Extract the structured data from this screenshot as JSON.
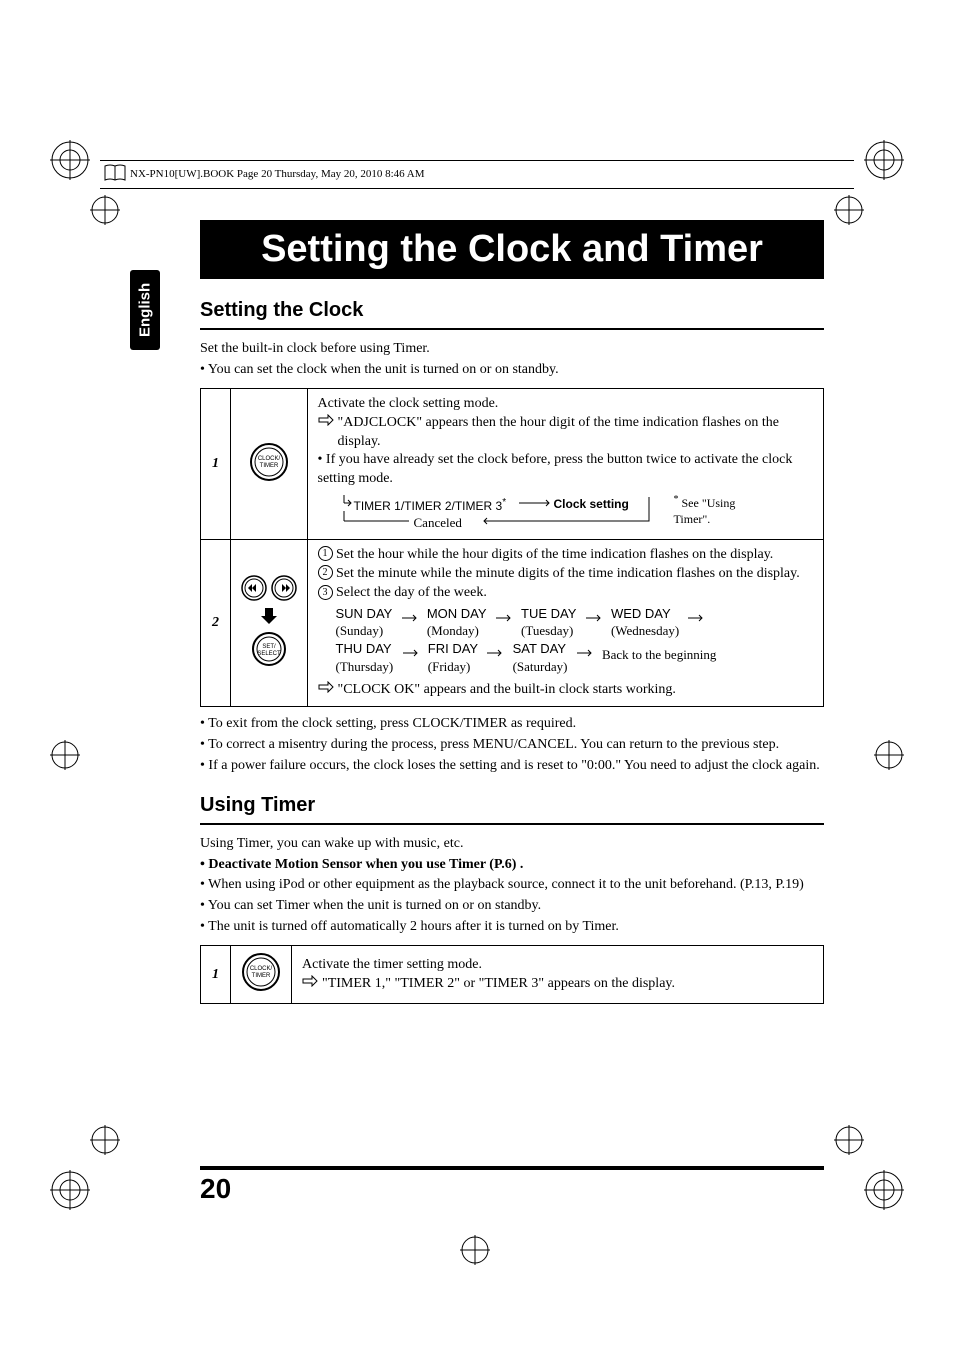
{
  "header": {
    "text": "NX-PN10[UW].BOOK  Page 20  Thursday, May 20, 2010  8:46 AM"
  },
  "side_tab": "English",
  "chapter_title": "Setting the Clock and Timer",
  "section1": {
    "title": "Setting the Clock",
    "intro1": "Set the built-in clock before using Timer.",
    "intro2": "• You can set the clock when the unit is turned on or on standby.",
    "step1": {
      "num": "1",
      "icon_label": "CLOCK/ TIMER",
      "line1": "Activate the clock setting mode.",
      "line2": "\"ADJCLOCK\" appears then the hour digit of the time indication flashes on the display.",
      "line3": "• If you have already set the clock before, press the button twice to activate the clock setting mode.",
      "flow_timer": "TIMER 1/TIMER 2/TIMER 3",
      "flow_setting": "Clock setting",
      "flow_canceled": "Canceled",
      "footnote_mark": "*",
      "footnote": "See \"Using Timer\"."
    },
    "step2": {
      "num": "2",
      "icon_prev": "prev-icon",
      "icon_next": "next-icon",
      "icon_set": "SET/ SELECT",
      "sub1": "Set the hour while the hour digits of the time indication flashes on the display.",
      "sub2": "Set the minute while the minute digits of the time indication flashes on the display.",
      "sub3": "Select the day of the week.",
      "days": [
        {
          "code": "SUN DAY",
          "name": "(Sunday)"
        },
        {
          "code": "MON DAY",
          "name": "(Monday)"
        },
        {
          "code": "TUE DAY",
          "name": "(Tuesday)"
        },
        {
          "code": "WED DAY",
          "name": "(Wednesday)"
        },
        {
          "code": "THU DAY",
          "name": "(Thursday)"
        },
        {
          "code": "FRI DAY",
          "name": "(Friday)"
        },
        {
          "code": "SAT DAY",
          "name": "(Saturday)"
        }
      ],
      "back_text": "Back to the beginning",
      "result": "\"CLOCK OK\" appears and the built-in clock starts working."
    },
    "after1": "• To exit from the clock setting, press CLOCK/TIMER as required.",
    "after2": "• To correct a misentry during the process, press MENU/CANCEL. You can return to the previous step.",
    "after3": "• If a power failure occurs, the clock loses the setting and is reset to \"0:00.\" You need to adjust the clock again."
  },
  "section2": {
    "title": "Using Timer",
    "intro1": "Using Timer, you can wake up with music, etc.",
    "intro2": "• Deactivate Motion Sensor when you use Timer (P.6) .",
    "intro3": "• When using iPod or other equipment as the playback source, connect it to the unit beforehand. (P.13, P.19)",
    "intro4": "• You can set Timer when the unit is turned on or on standby.",
    "intro5": "• The unit is turned off automatically 2 hours after it is turned on by Timer.",
    "step1": {
      "num": "1",
      "icon_label": "CLOCK/ TIMER",
      "line1": "Activate the timer setting mode.",
      "line2": "\"TIMER 1,\" \"TIMER 2\" or \"TIMER 3\" appears on the display."
    }
  },
  "page_number": "20"
}
